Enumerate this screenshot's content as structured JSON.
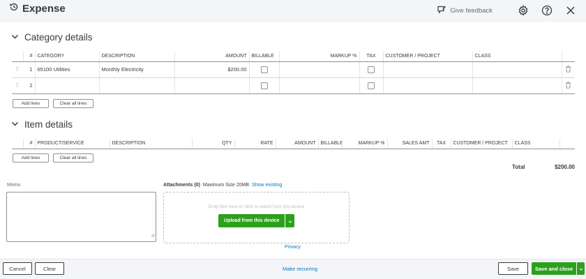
{
  "header": {
    "title": "Expense",
    "feedback_label": "Give feedback"
  },
  "category_details": {
    "title": "Category details",
    "columns": [
      "#",
      "CATEGORY",
      "DESCRIPTION",
      "AMOUNT",
      "BILLABLE",
      "MARKUP %",
      "TAX",
      "CUSTOMER / PROJECT",
      "CLASS"
    ],
    "rows": [
      {
        "num": "1",
        "category": "65100 Utilities",
        "description": "Monthly Electricity",
        "amount": "$200.00"
      },
      {
        "num": "2",
        "category": "",
        "description": "",
        "amount": ""
      }
    ],
    "add_lines": "Add lines",
    "clear_lines": "Clear all lines"
  },
  "item_details": {
    "title": "Item details",
    "columns": [
      "#",
      "PRODUCT/SERVICE",
      "DESCRIPTION",
      "QTY",
      "RATE",
      "AMOUNT",
      "BILLABLE",
      "MARKUP %",
      "SALES AMT",
      "TAX",
      "CUSTOMER / PROJECT",
      "CLASS"
    ],
    "add_lines": "Add lines",
    "clear_lines": "Clear all lines"
  },
  "total": {
    "label": "Total",
    "value": "$200.00"
  },
  "memo": {
    "label": "Memo",
    "value": ""
  },
  "attachments": {
    "label": "Attachments (0)",
    "max_size": "Maximum Size 20MB",
    "show_existing": "Show existing",
    "drop_hint": "Drop files here or click to select from this device",
    "upload_label": "Upload from this device"
  },
  "privacy": "Privacy",
  "footer": {
    "cancel": "Cancel",
    "clear": "Clear",
    "make_recurring": "Make recurring",
    "save": "Save",
    "save_and_close": "Save and close"
  },
  "colors": {
    "accent": "#2ca01c",
    "link": "#0077c5",
    "text": "#393a3d",
    "header_bg": "#f4f5f8"
  }
}
